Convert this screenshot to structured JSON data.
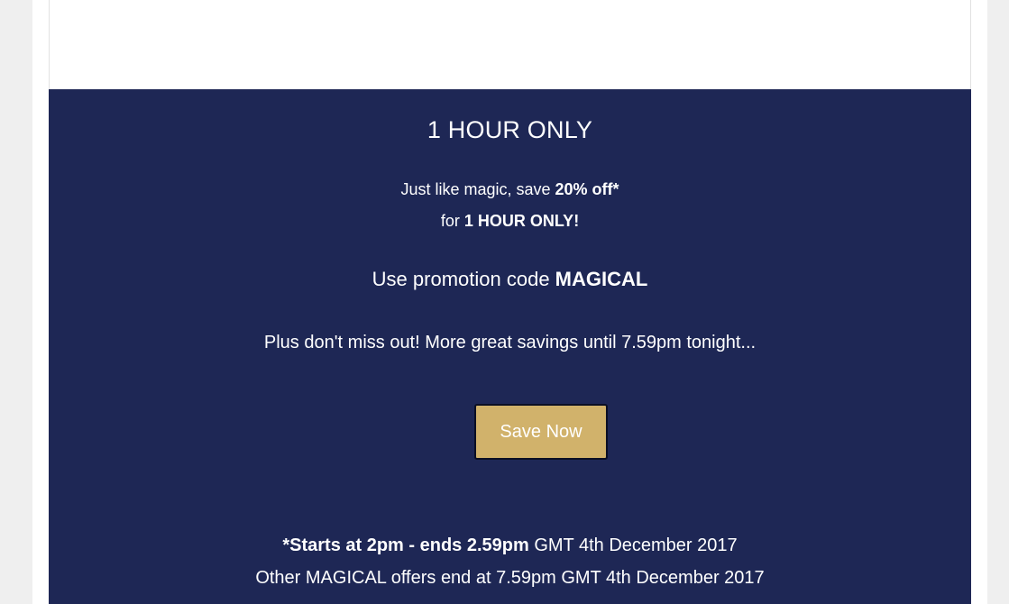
{
  "colors": {
    "page_background": "#efefef",
    "panel_background": "#1e2755",
    "button_background": "#d1b26b",
    "text": "#ffffff"
  },
  "promo": {
    "title": "1 HOUR ONLY",
    "line1_prefix": "Just like magic, save ",
    "line1_bold": "20% off*",
    "line2_prefix": "for ",
    "line2_bold": "1 HOUR ONLY!",
    "code_prefix": "Use promotion code ",
    "code_value": "MAGICAL",
    "plus_text": "Plus don't miss out! More great savings until 7.59pm tonight..."
  },
  "button": {
    "label": "Save Now"
  },
  "terms": {
    "line1_bold": "*Starts at 2pm - ends 2.59pm",
    "line1_rest": " GMT 4th December 2017",
    "line2": "Other MAGICAL offers end at 7.59pm GMT 4th December 2017"
  }
}
